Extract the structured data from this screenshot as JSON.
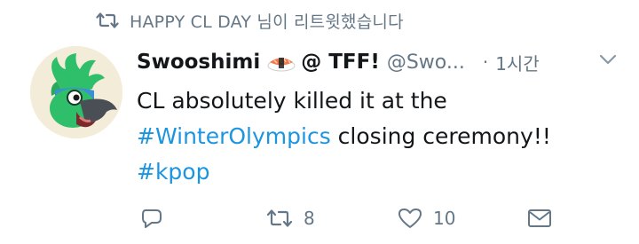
{
  "retweet": {
    "icon": "retweet-icon",
    "text": "HAPPY CL DAY 님이 리트윗했습니다"
  },
  "tweet": {
    "avatar": "avatar",
    "display_name": "Swooshimi",
    "display_name_suffix": "@ TFF!",
    "name_emoji_icon": "sushi-icon",
    "handle": "@Swo...",
    "dot": "·",
    "time": "1시간",
    "text_part1": "CL absolutely killed it at the",
    "hashtag1": "#WinterOlympics",
    "text_part2": " closing ceremony!!",
    "hashtag2": "#kpop"
  },
  "actions": {
    "reply_icon": "reply-icon",
    "retweet_icon": "retweet-icon",
    "retweet_count": "8",
    "like_icon": "heart-icon",
    "like_count": "10",
    "dm_icon": "envelope-icon"
  },
  "colors": {
    "text": "#14171a",
    "secondary": "#657786",
    "link": "#1b95e0"
  }
}
